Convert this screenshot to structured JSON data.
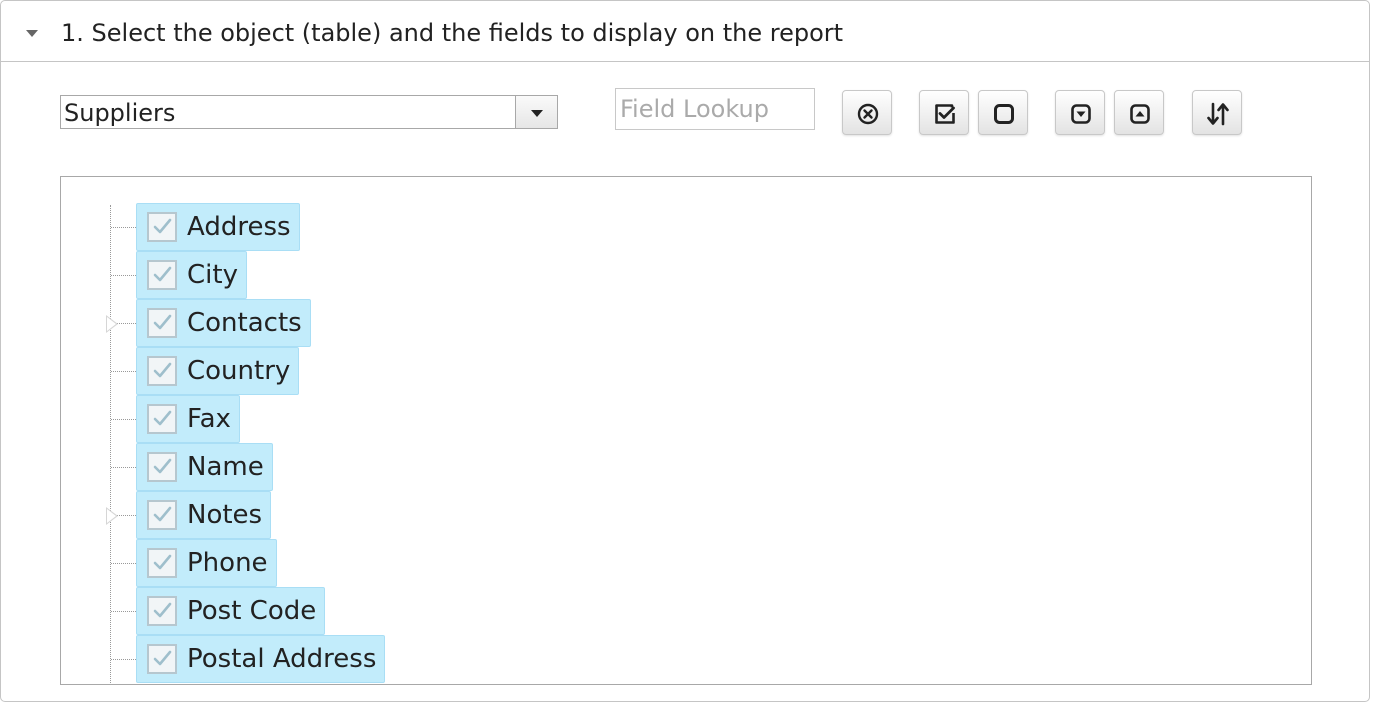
{
  "panel": {
    "title": "1. Select the object (table) and the fields to display on the report"
  },
  "object_select": {
    "value": "Suppliers"
  },
  "field_lookup": {
    "placeholder": "Field Lookup",
    "value": ""
  },
  "toolbar": {
    "buttons": [
      {
        "name": "clear-lookup-button",
        "icon": "circle-x-icon"
      },
      {
        "name": "select-all-button",
        "icon": "checked-box-icon"
      },
      {
        "name": "deselect-all-button",
        "icon": "empty-box-icon"
      },
      {
        "name": "expand-all-button",
        "icon": "box-arrow-down-icon"
      },
      {
        "name": "collapse-all-button",
        "icon": "box-arrow-up-icon"
      },
      {
        "name": "sort-button",
        "icon": "sort-arrows-icon"
      }
    ]
  },
  "colors": {
    "chip_background": "#c2ecfb",
    "chip_border": "#a9def5",
    "checkmark": "#9fbfcc"
  },
  "tree": {
    "nodes": [
      {
        "label": "Address",
        "checked": true,
        "expandable": false
      },
      {
        "label": "City",
        "checked": true,
        "expandable": false
      },
      {
        "label": "Contacts",
        "checked": true,
        "expandable": true
      },
      {
        "label": "Country",
        "checked": true,
        "expandable": false
      },
      {
        "label": "Fax",
        "checked": true,
        "expandable": false
      },
      {
        "label": "Name",
        "checked": true,
        "expandable": false
      },
      {
        "label": "Notes",
        "checked": true,
        "expandable": true
      },
      {
        "label": "Phone",
        "checked": true,
        "expandable": false
      },
      {
        "label": "Post Code",
        "checked": true,
        "expandable": false
      },
      {
        "label": "Postal Address",
        "checked": true,
        "expandable": false
      }
    ]
  }
}
